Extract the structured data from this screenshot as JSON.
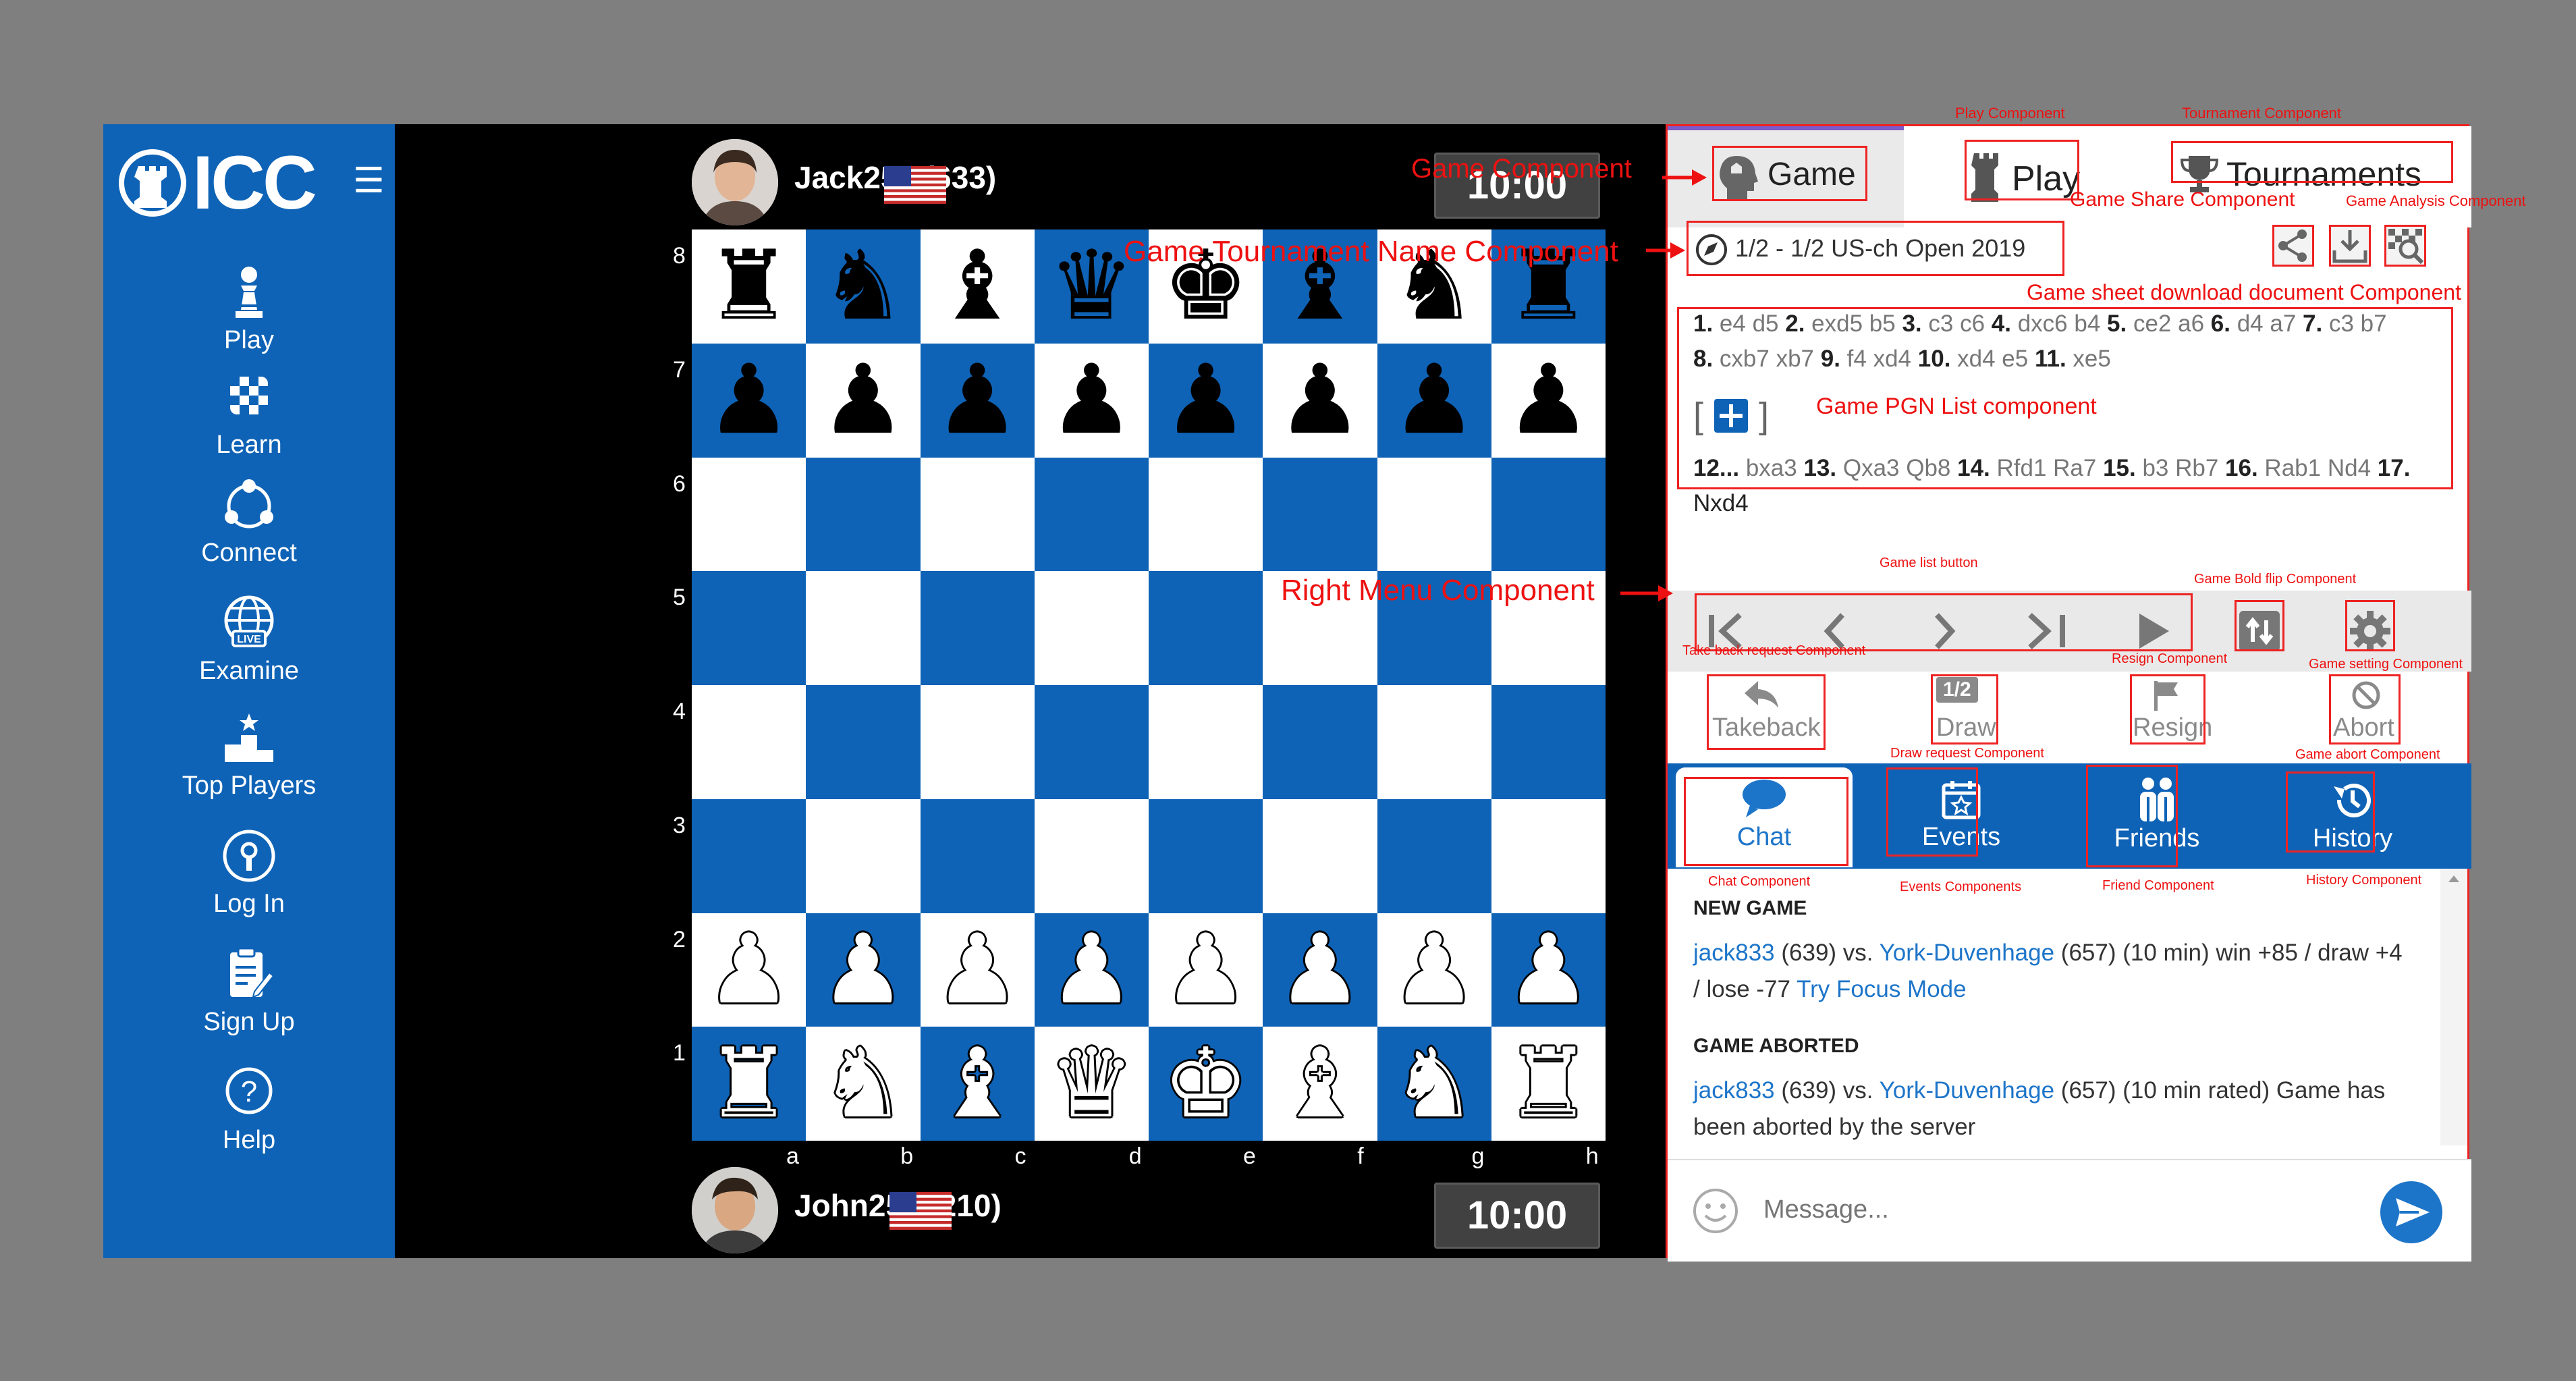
{
  "sidebar": {
    "logo": "ICC",
    "menu_icon": "hamburger-icon",
    "items": [
      {
        "label": "Play",
        "icon": "pawn-icon"
      },
      {
        "label": "Learn",
        "icon": "checker-icon"
      },
      {
        "label": "Connect",
        "icon": "network-icon"
      },
      {
        "label": "Examine",
        "icon": "globe-live-icon"
      },
      {
        "label": "Top Players",
        "icon": "podium-icon"
      },
      {
        "label": "Log In",
        "icon": "login-icon"
      },
      {
        "label": "Sign Up",
        "icon": "signup-icon"
      },
      {
        "label": "Help",
        "icon": "help-icon"
      }
    ]
  },
  "board": {
    "top_player": {
      "name": "Jack256 (633)",
      "clock": "10:00",
      "flag": "us-flag"
    },
    "bottom_player": {
      "name": "John256 (210)",
      "clock": "10:00",
      "flag": "us-flag"
    },
    "ranks": [
      "8",
      "7",
      "6",
      "5",
      "4",
      "3",
      "2",
      "1"
    ],
    "files": [
      "a",
      "b",
      "c",
      "d",
      "e",
      "f",
      "g",
      "h"
    ],
    "position": [
      [
        "br",
        "bn",
        "bb",
        "bq",
        "bk",
        "bb",
        "bn",
        "br"
      ],
      [
        "bp",
        "bp",
        "bp",
        "bp",
        "bp",
        "bp",
        "bp",
        "bp"
      ],
      [
        "",
        "",
        "",
        "",
        "",
        "",
        "",
        ""
      ],
      [
        "",
        "",
        "",
        "",
        "",
        "",
        "",
        ""
      ],
      [
        "",
        "",
        "",
        "",
        "",
        "",
        "",
        ""
      ],
      [
        "",
        "",
        "",
        "",
        "",
        "",
        "",
        ""
      ],
      [
        "wp",
        "wp",
        "wp",
        "wp",
        "wp",
        "wp",
        "wp",
        "wp"
      ],
      [
        "wr",
        "wn",
        "wb",
        "wq",
        "wk",
        "wb",
        "wn",
        "wr"
      ]
    ],
    "colors": {
      "light": "#ffffff",
      "dark": "#0f63b6"
    }
  },
  "right_panel": {
    "tabs": {
      "game": "Game",
      "play": "Play",
      "tournaments": "Tournaments"
    },
    "tournament_name": "1/2 - 1/2 US-ch Open 2019",
    "pgn_line1": "e4 d5 exd5 b5 c3 c6 dxc6 b4 ce2 a6 d4 a7 c3 b7",
    "pgn_tokens_1": [
      {
        "n": "1.",
        "m": "e4 d5"
      },
      {
        "n": "2.",
        "m": "exd5 b5"
      },
      {
        "n": "3.",
        "m": "c3 c6"
      },
      {
        "n": "4.",
        "m": "dxc6 b4"
      },
      {
        "n": "5.",
        "m": "ce2 a6"
      },
      {
        "n": "6.",
        "m": "d4 a7"
      },
      {
        "n": "7.",
        "m": "c3 b7"
      }
    ],
    "pgn_tokens_2": [
      {
        "n": "8.",
        "m": "cxb7 xb7"
      },
      {
        "n": "9.",
        "m": "f4 xd4"
      },
      {
        "n": "10.",
        "m": "xd4 e5"
      },
      {
        "n": "11.",
        "m": "xe5"
      }
    ],
    "pgn_tokens_3": [
      {
        "n": "12...",
        "m": "bxa3"
      },
      {
        "n": "13.",
        "m": "Qxa3 Qb8"
      },
      {
        "n": "14.",
        "m": "Rfd1 Ra7"
      },
      {
        "n": "15.",
        "m": "b3 Rb7"
      },
      {
        "n": "16.",
        "m": "Rab1 Nd4"
      },
      {
        "n": "17.",
        "m": ""
      }
    ],
    "pgn_line4": "Nxd4",
    "pgn_expand": "[ + ]",
    "actions": {
      "takeback": "Takeback",
      "draw": "Draw",
      "draw_badge": "1/2",
      "resign": "Resign",
      "abort": "Abort"
    },
    "bottom_tabs": {
      "chat": "Chat",
      "events": "Events",
      "friends": "Friends",
      "history": "History"
    },
    "chat": {
      "head1": "NEW GAME",
      "msg1_user1": "jack833",
      "msg1_mid": " (639) vs. ",
      "msg1_user2": "York-Duvenhage",
      "msg1_tail": " (657) (10 min) win +85 / draw +4 / lose -77 ",
      "msg1_link": "Try Focus Mode",
      "head2": "GAME ABORTED",
      "msg2_user1": "jack833",
      "msg2_mid": " (639) vs. ",
      "msg2_user2": "York-Duvenhage",
      "msg2_tail": " (657) (10 min rated) Game has been aborted by the server"
    },
    "message_placeholder": "Message..."
  },
  "annotations": {
    "game": "Game Component",
    "play": "Play Component",
    "tournament": "Tournament  Component",
    "share": "Game Share Component",
    "analysis": "Game Analysis Component",
    "tournament_name": "Game Tournament Name Component",
    "download": "Game sheet download document Component",
    "pgn": "Game PGN List component",
    "right_menu": "Right Menu Component",
    "list_button": "Game list button",
    "flip": "Game Bold flip Component",
    "takeback": "Take back request Component",
    "resign": "Resign Component",
    "setting": "Game setting Component",
    "draw": "Draw request Component",
    "abort": "Game abort Component",
    "chat": "Chat Component",
    "events": "Events Components",
    "friends": "Friend Component",
    "history": "History Component"
  }
}
